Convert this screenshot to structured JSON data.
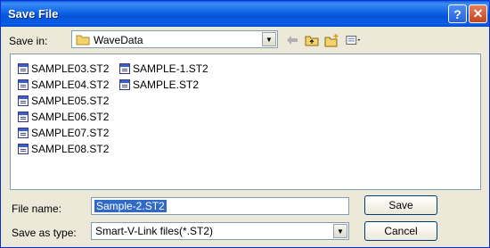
{
  "window": {
    "title": "Save File"
  },
  "toolbar": {
    "save_in_label": "Save in:",
    "save_in_value": "WaveData"
  },
  "files": [
    "SAMPLE03.ST2",
    "SAMPLE04.ST2",
    "SAMPLE05.ST2",
    "SAMPLE06.ST2",
    "SAMPLE07.ST2",
    "SAMPLE08.ST2",
    "SAMPLE-1.ST2",
    "SAMPLE.ST2"
  ],
  "form": {
    "file_name_label": "File name:",
    "file_name_value": "Sample-2.ST2",
    "save_as_type_label": "Save as type:",
    "save_as_type_value": "Smart-V-Link files(*.ST2)"
  },
  "buttons": {
    "save": "Save",
    "cancel": "Cancel"
  },
  "icons": {
    "help": "?",
    "close": "✕",
    "dropdown": "▼"
  }
}
